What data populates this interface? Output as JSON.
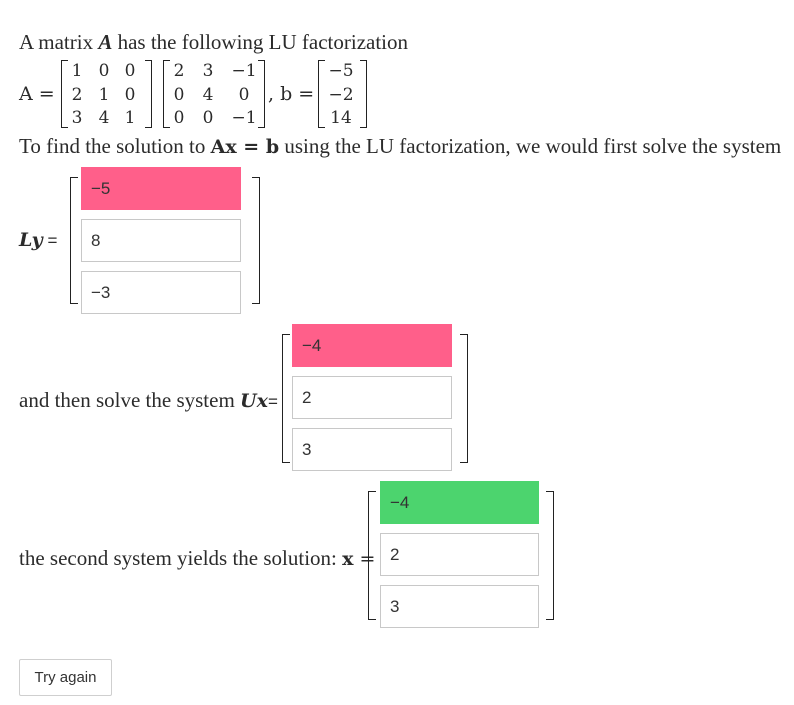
{
  "problem": {
    "intro_prefix": "A matrix ",
    "intro_var": "A",
    "intro_suffix": " has the following LU factorization",
    "a_label": "A =",
    "b_label": ", b =",
    "L": [
      [
        "1",
        "0",
        "0"
      ],
      [
        "2",
        "1",
        "0"
      ],
      [
        "3",
        "4",
        "1"
      ]
    ],
    "U": [
      [
        "2",
        "3",
        "−1"
      ],
      [
        "0",
        "4",
        "0"
      ],
      [
        "0",
        "0",
        "−1"
      ]
    ],
    "b": [
      "−5",
      "−2",
      "14"
    ],
    "find_prefix": "To find the solution to ",
    "find_eq": "Ax = b",
    "find_suffix": " using the LU factorization, we would first solve the system"
  },
  "ly": {
    "label_var": "Ly",
    "label_eq": "=",
    "values": [
      "−5",
      "8",
      "−3"
    ],
    "status": [
      "incorrect",
      "neutral",
      "neutral"
    ]
  },
  "ux": {
    "label_prefix": "and then solve the system ",
    "label_var": "Ux",
    "label_eq": "=",
    "values": [
      "−4",
      "2",
      "3"
    ],
    "status": [
      "incorrect",
      "neutral",
      "neutral"
    ]
  },
  "solution": {
    "label_prefix": "the second system yields the solution: ",
    "label_var": "x",
    "label_eq": " =",
    "values": [
      "−4",
      "2",
      "3"
    ],
    "status": [
      "correct",
      "neutral",
      "neutral"
    ]
  },
  "actions": {
    "try_again": "Try again"
  },
  "colors": {
    "incorrect": "#ff5f8a",
    "correct": "#4cd46e",
    "neutral": "#ffffff"
  }
}
